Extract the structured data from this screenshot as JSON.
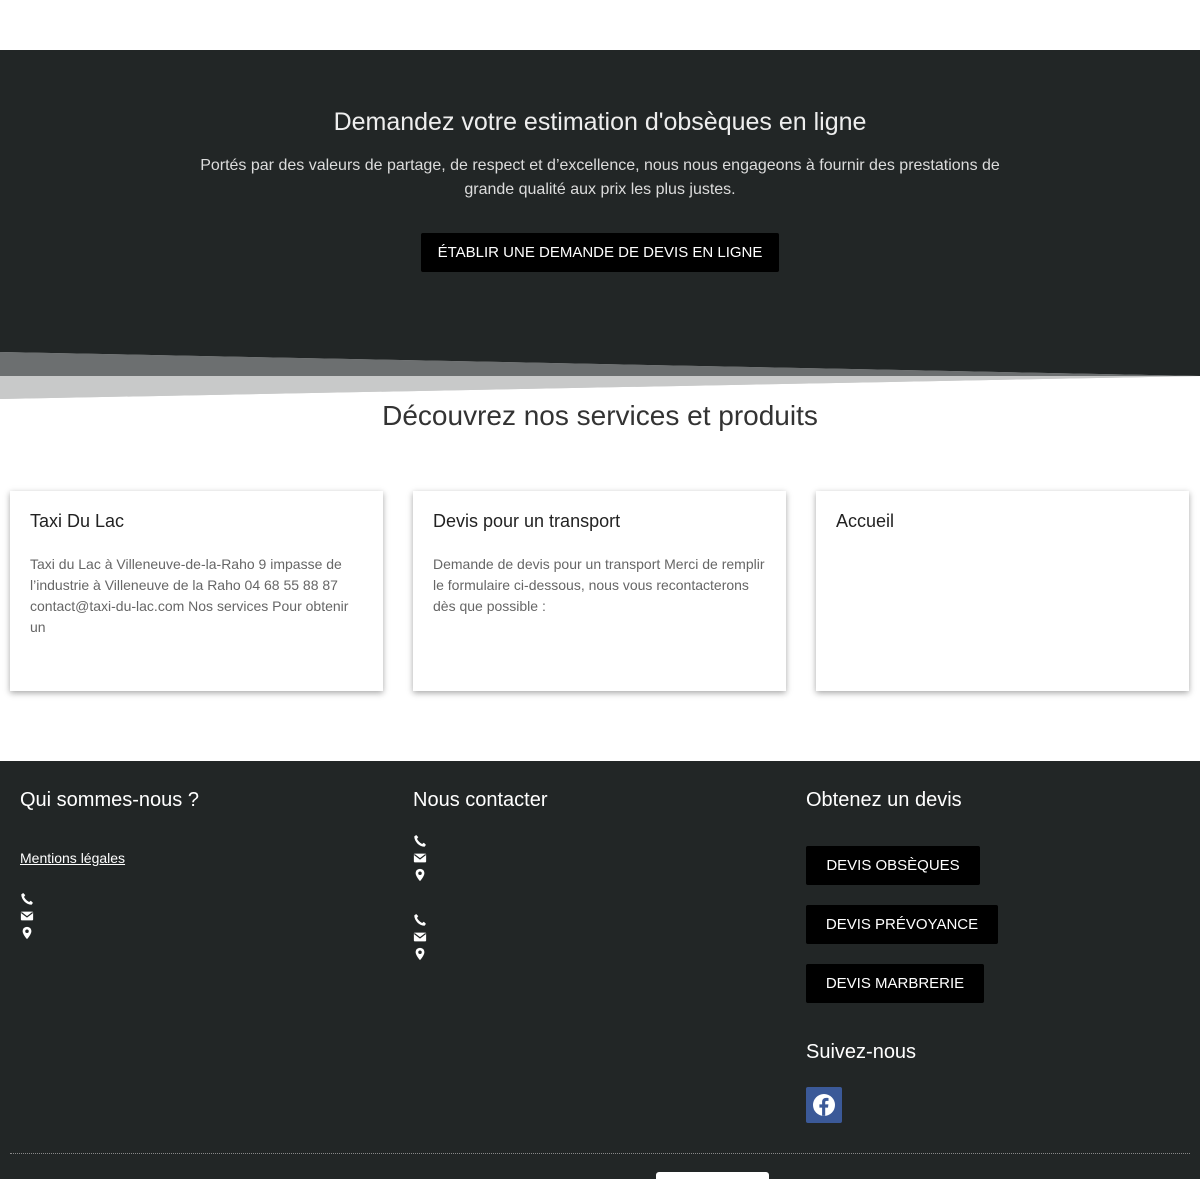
{
  "hero": {
    "title": "Demandez votre estimation d'obsèques en ligne",
    "text": "Portés par des valeurs de partage, de respect et d’excellence, nous nous engageons à fournir des prestations de grande qualité aux prix les plus justes.",
    "button_label": "ÉTABLIR UNE DEMANDE DE DEVIS EN LIGNE"
  },
  "services": {
    "title": "Découvrez nos services et produits",
    "cards": [
      {
        "title": "Taxi Du Lac",
        "text": "Taxi du Lac à Villeneuve-de-la-Raho 9 impasse de l’industrie à Villeneuve de la Raho 04 68 55 88 87 contact@taxi-du-lac.com Nos services Pour obtenir un"
      },
      {
        "title": "Devis pour un transport",
        "text": "Demande de devis pour un transport Merci de remplir le formulaire ci-dessous, nous vous recontacterons dès que possible :"
      },
      {
        "title": "Accueil",
        "text": ""
      }
    ]
  },
  "footer": {
    "about": {
      "title": "Qui sommes-nous ?",
      "link_label": "Mentions légales"
    },
    "contact": {
      "title": "Nous contacter"
    },
    "quote": {
      "title": "Obtenez un devis",
      "buttons": [
        "DEVIS OBSÈQUES",
        "DEVIS PRÉVOYANCE",
        "DEVIS MARBRERIE"
      ]
    },
    "follow": {
      "title": "Suivez-nous"
    }
  },
  "icons": {
    "phone": "phone-icon",
    "mail": "envelope-icon",
    "location": "map-marker-icon",
    "social": "facebook-icon"
  },
  "colors": {
    "dark": "#222626",
    "button": "#000000",
    "facebook": "#3b5998"
  }
}
